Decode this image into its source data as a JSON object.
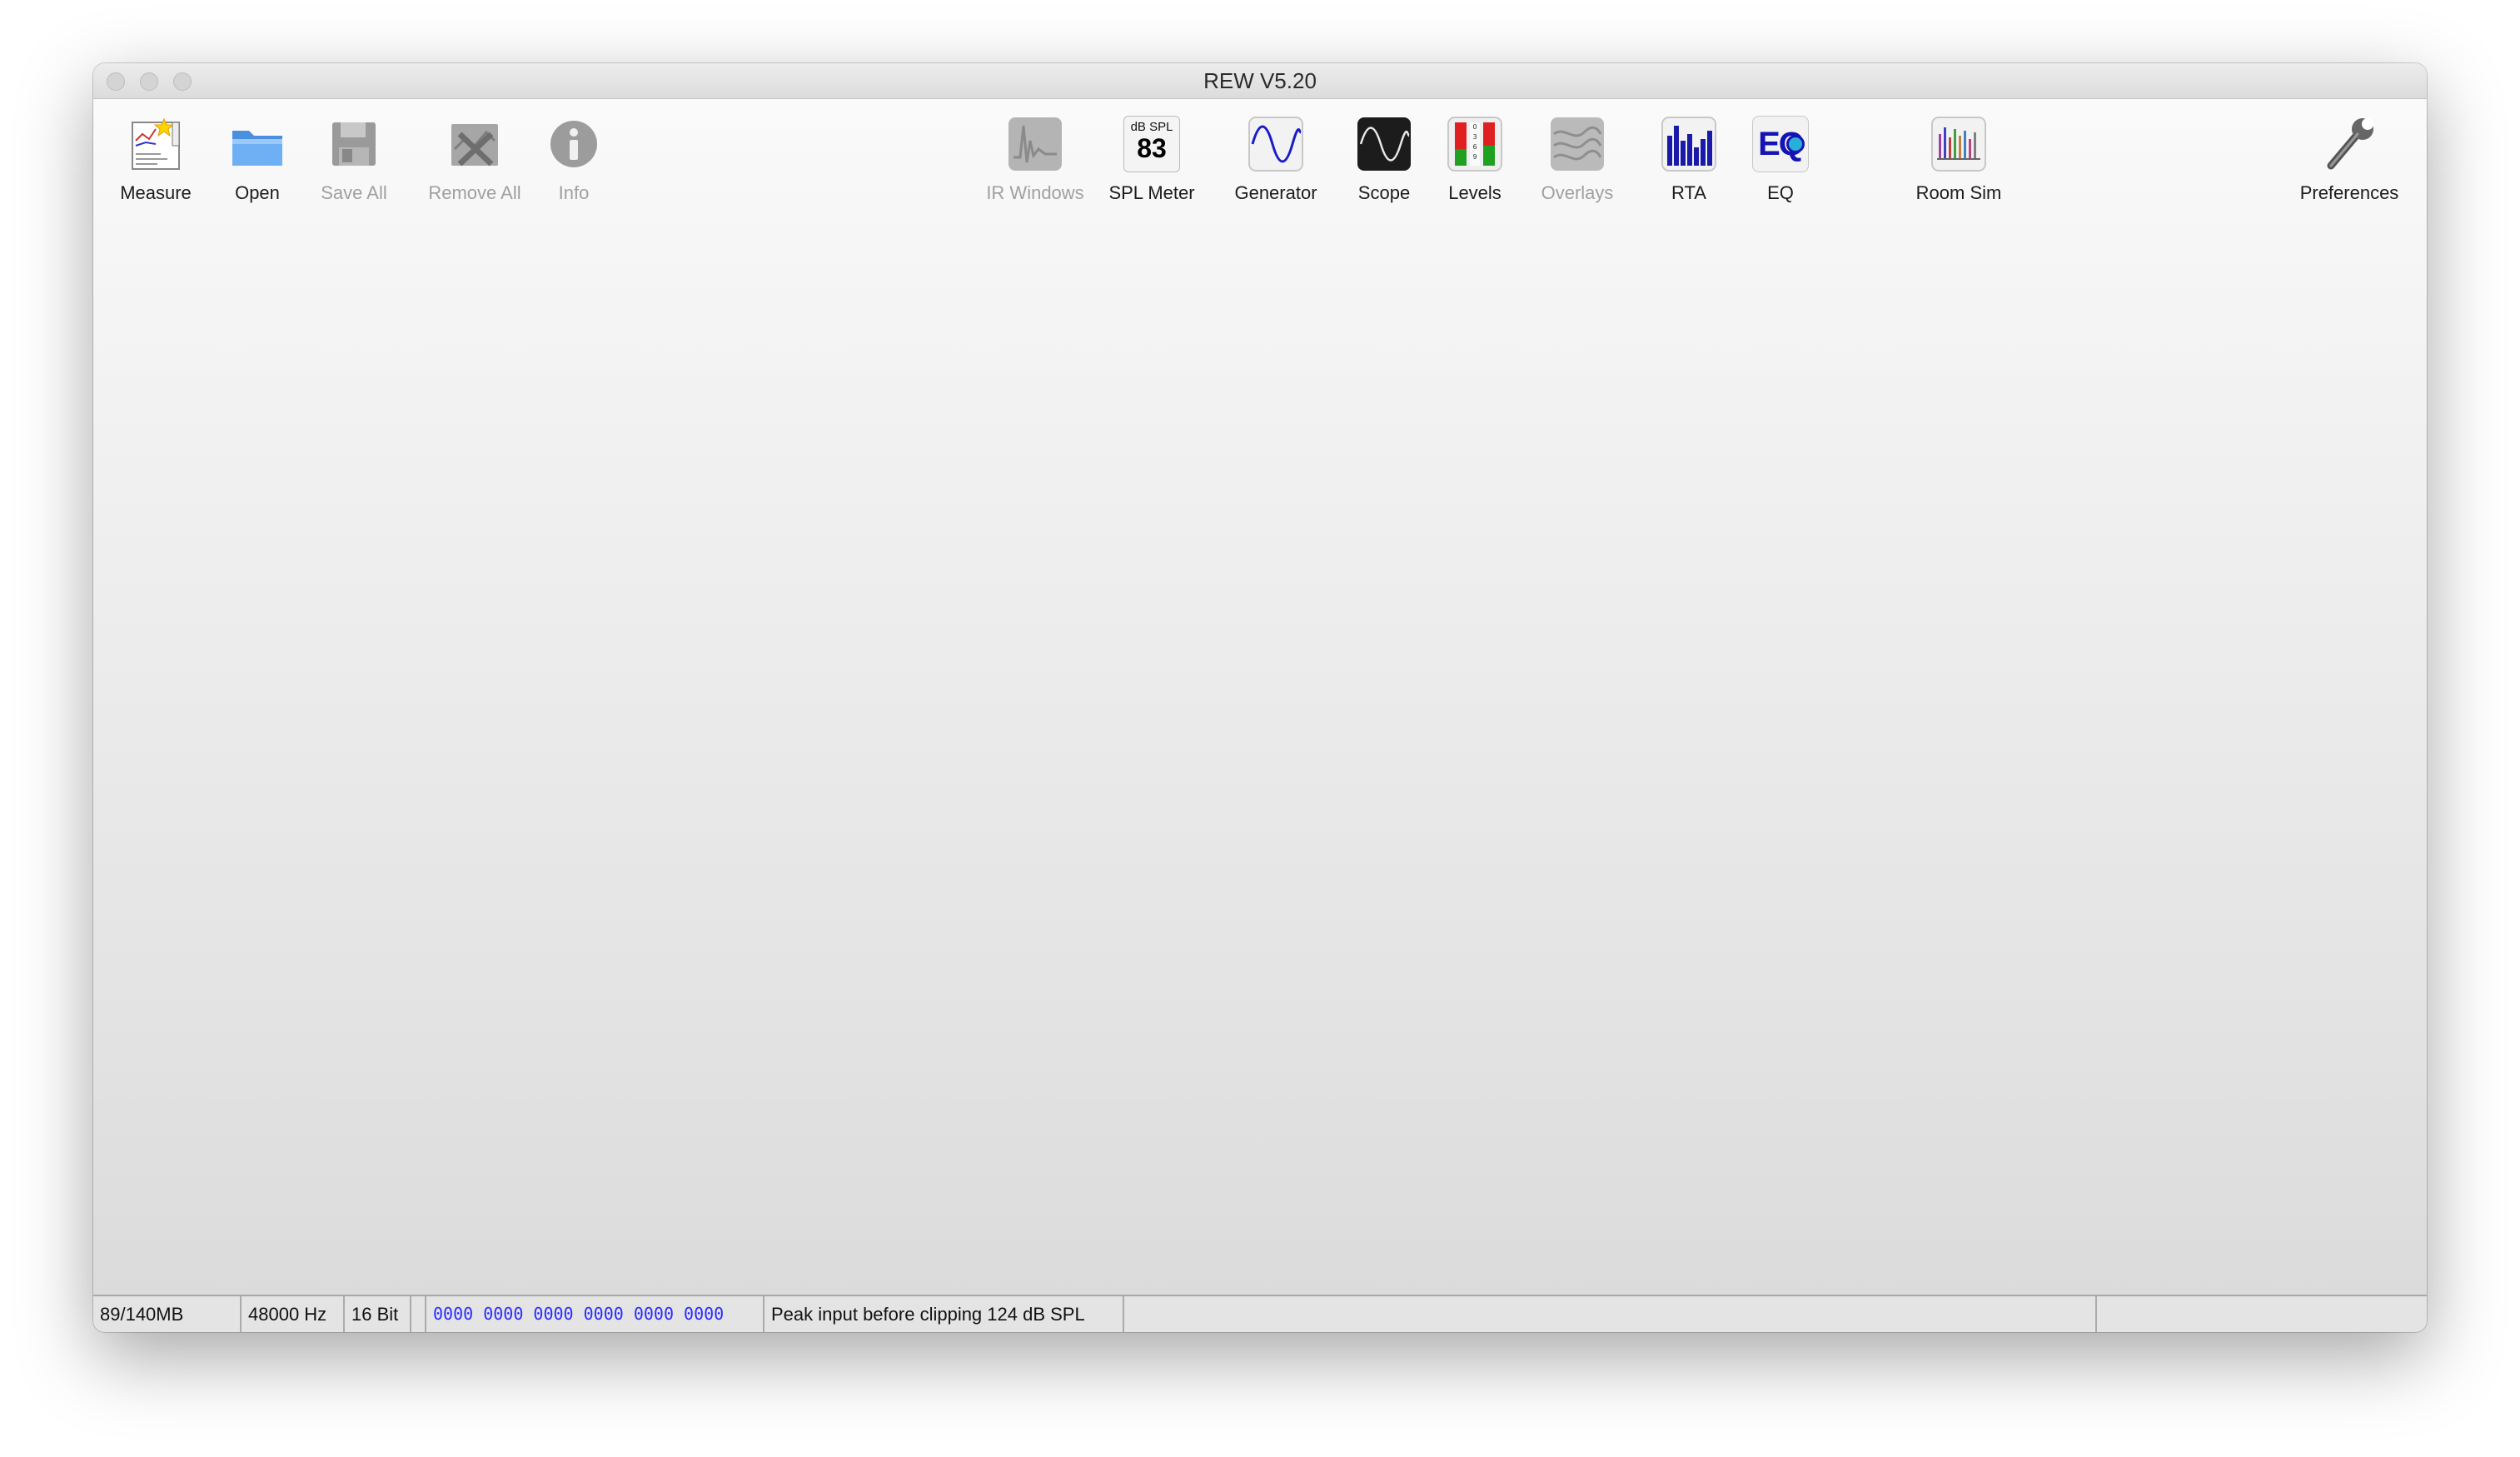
{
  "window": {
    "title": "REW V5.20"
  },
  "toolbar": {
    "measure": "Measure",
    "open": "Open",
    "save_all": "Save All",
    "remove_all": "Remove All",
    "info": "Info",
    "ir_windows": "IR Windows",
    "spl_meter": "SPL Meter",
    "spl_meter_icon_unit": "dB SPL",
    "spl_meter_icon_value": "83",
    "generator": "Generator",
    "scope": "Scope",
    "levels": "Levels",
    "overlays": "Overlays",
    "rta": "RTA",
    "eq": "EQ",
    "eq_icon_text": "EQ",
    "room_sim": "Room Sim",
    "preferences": "Preferences"
  },
  "status": {
    "memory": "89/140MB",
    "sample_rate": "48000 Hz",
    "bit_depth": "16 Bit",
    "bit_display": "0000 0000  0000 0000  0000 0000",
    "peak_input": "Peak input before clipping 124 dB SPL"
  },
  "colors": {
    "bit_display": "#2a2aff",
    "disabled_label": "#a0a0a0"
  }
}
